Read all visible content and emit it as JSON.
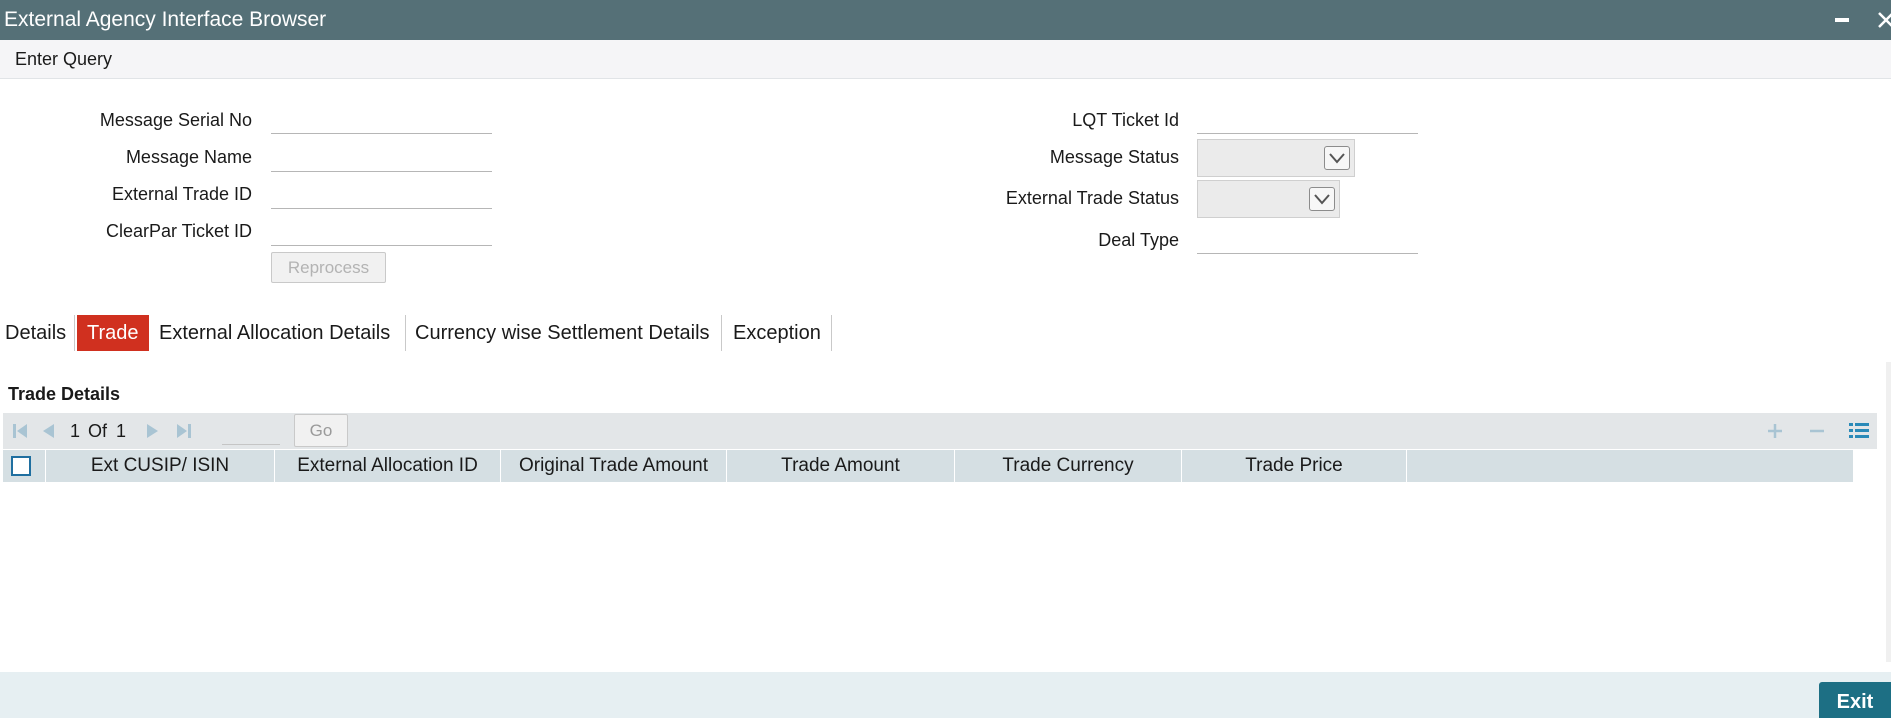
{
  "window": {
    "title": "External Agency Interface Browser"
  },
  "menu": {
    "enter_query": "Enter Query"
  },
  "form": {
    "message_serial_no": {
      "label": "Message Serial No",
      "value": ""
    },
    "message_name": {
      "label": "Message Name",
      "value": ""
    },
    "external_trade_id": {
      "label": "External Trade ID",
      "value": ""
    },
    "clearpar_ticket_id": {
      "label": "ClearPar Ticket ID",
      "value": ""
    },
    "lqt_ticket_id": {
      "label": "LQT Ticket Id",
      "value": ""
    },
    "message_status": {
      "label": "Message Status",
      "value": ""
    },
    "external_trade_status": {
      "label": "External Trade Status",
      "value": ""
    },
    "deal_type": {
      "label": "Deal Type",
      "value": ""
    },
    "reprocess_label": "Reprocess"
  },
  "tabs": [
    {
      "label": "Details"
    },
    {
      "label": "Trade",
      "active": true
    },
    {
      "label": "External Allocation Details"
    },
    {
      "label": "Currency wise Settlement Details"
    },
    {
      "label": "Exception"
    }
  ],
  "trade_details": {
    "title": "Trade Details",
    "pager": {
      "current": "1",
      "of_label": "Of",
      "total": "1",
      "go_label": "Go"
    },
    "columns": [
      "Ext CUSIP/ ISIN",
      "External Allocation ID",
      "Original Trade Amount",
      "Trade Amount",
      "Trade Currency",
      "Trade Price"
    ],
    "rows": []
  },
  "footer": {
    "exit_label": "Exit"
  },
  "colors": {
    "title_bar": "#557077",
    "active_tab": "#d0301f",
    "exit_button": "#1d6f84",
    "table_header": "#d5dfe3"
  }
}
